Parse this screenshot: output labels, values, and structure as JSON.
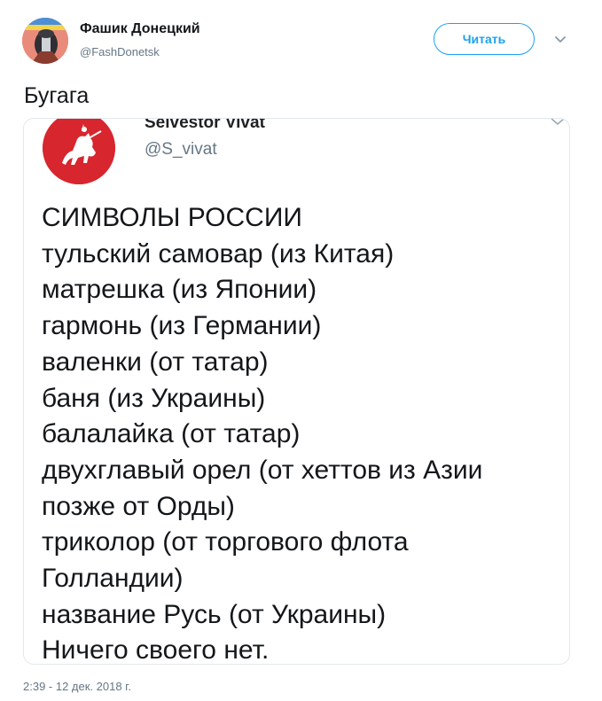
{
  "author": {
    "name": "Фашик Донецкий",
    "handle": "@FashDonetsk"
  },
  "follow_label": "Читать",
  "tweet_text": "Бугага",
  "embedded": {
    "name": "Selvestor Vivat",
    "handle": "@S_vivat",
    "lines": [
      "СИМВОЛЫ РОССИИ",
      "тульский самовар (из Китая)",
      "матрешка (из Японии)",
      "гармонь (из Германии)",
      "валенки (от татар)",
      "баня (из Украины)",
      "балалайка (от татар)",
      "двухглавый орел (от хеттов из Азии",
      "позже от Орды)",
      "триколор (от торгового флота",
      "Голландии)",
      "название Русь (от Украины)",
      "Ничего своего нет."
    ]
  },
  "timestamp": "2:39 - 12 дек. 2018 г.",
  "icons": {
    "avatar": "profile-avatar-icon",
    "caret": "chevron-down-icon",
    "embedded_avatar": "pahonia-coat-of-arms-icon"
  },
  "colors": {
    "accent": "#1da1f2",
    "secondary_text": "#657786",
    "text": "#14171a",
    "border": "#e1e8ed",
    "embedded_avatar_bg": "#d7262e"
  }
}
